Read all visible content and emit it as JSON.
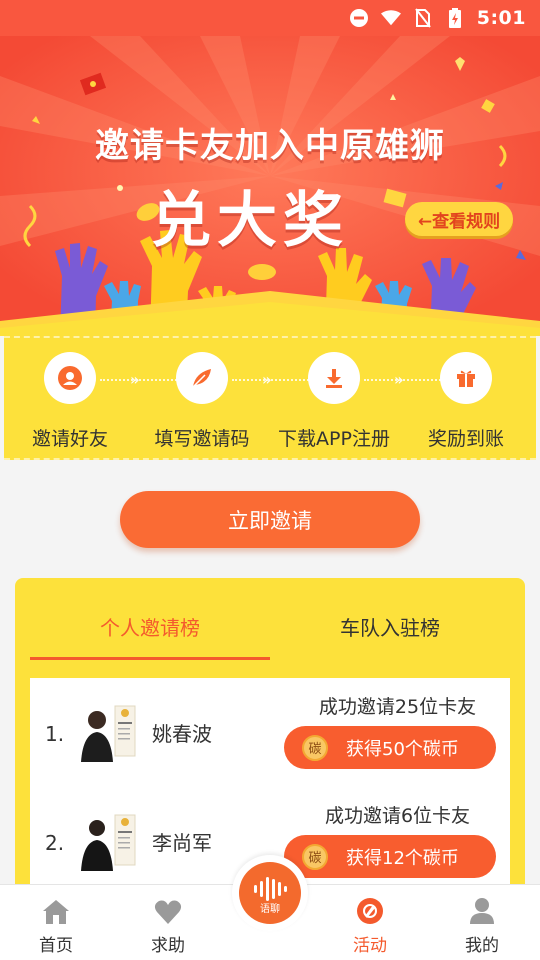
{
  "status_bar": {
    "time": "5:01"
  },
  "banner": {
    "line1": "邀请卡友加入中原雄狮",
    "line2": "兑大奖",
    "rules_button": "←查看规则",
    "background_color": "#f8553e"
  },
  "steps": [
    {
      "label": "邀请好友",
      "icon": "user-icon"
    },
    {
      "label": "填写邀请码",
      "icon": "feather-pen-icon"
    },
    {
      "label": "下载APP注册",
      "icon": "download-icon"
    },
    {
      "label": "奖励到账",
      "icon": "gift-icon"
    }
  ],
  "invite_button": "立即邀请",
  "ranking": {
    "tabs": [
      {
        "label": "个人邀请榜",
        "active": true
      },
      {
        "label": "车队入驻榜",
        "active": false
      }
    ],
    "rows": [
      {
        "rank": "1.",
        "name": "姚春波",
        "desc": "成功邀请25位卡友",
        "coin_icon": "碳",
        "reward": "获得50个碳币"
      },
      {
        "rank": "2.",
        "name": "李尚军",
        "desc": "成功邀请6位卡友",
        "coin_icon": "碳",
        "reward": "获得12个碳币"
      }
    ]
  },
  "bottom_nav": {
    "items": [
      {
        "label": "首页",
        "icon": "home-icon"
      },
      {
        "label": "求助",
        "icon": "heart-icon"
      },
      {
        "label": "活动",
        "icon": "activity-icon",
        "active": true
      },
      {
        "label": "我的",
        "icon": "profile-icon"
      }
    ],
    "center": {
      "label": "语聊",
      "icon": "voice-wave-icon"
    }
  },
  "colors": {
    "accent": "#f45a2d",
    "yellow": "#fde13b",
    "button": "#fa6b34"
  }
}
